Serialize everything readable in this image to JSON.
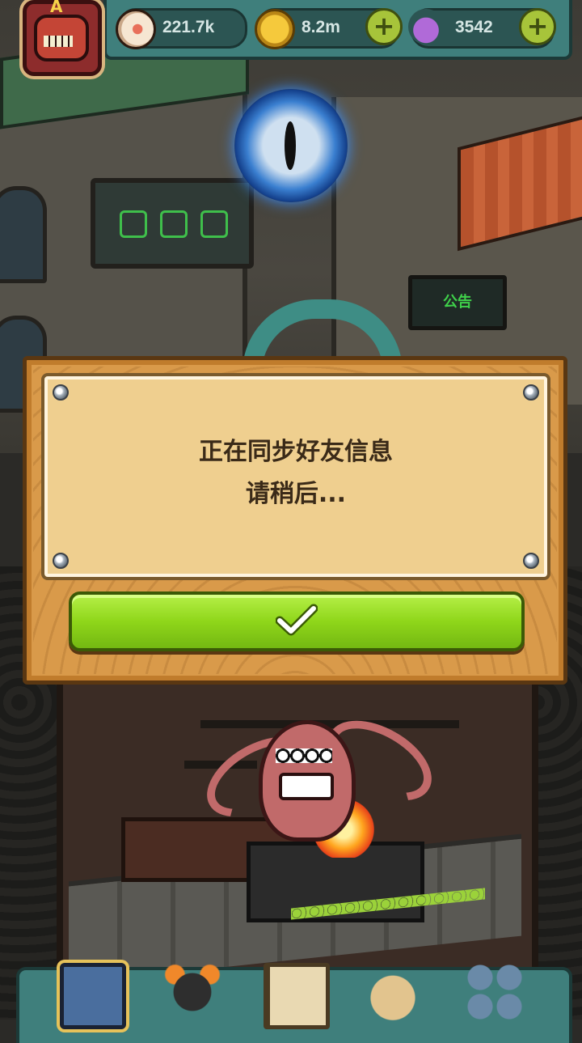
{
  "hud": {
    "avatar_letter": "A",
    "eyes": {
      "value": "221.7k",
      "icon": "eyeball-icon"
    },
    "coins": {
      "value": "8.2m",
      "icon": "coin-icon",
      "add_icon": "plus-icon"
    },
    "potions": {
      "value": "3542",
      "icon": "potion-icon",
      "add_icon": "plus-icon"
    }
  },
  "scene": {
    "announcement_sign": "公告"
  },
  "dialog": {
    "line1": "正在同步好友信息",
    "line2": "请稍后...",
    "confirm_icon": "checkmark-icon"
  },
  "bottom_nav": {
    "items": [
      {
        "icon": "building-icon"
      },
      {
        "icon": "monster-icon"
      },
      {
        "icon": "book-icon"
      },
      {
        "icon": "money-bag-icon"
      },
      {
        "icon": "grid-menu-icon"
      }
    ]
  },
  "colors": {
    "hud_teal": "#3f7f7c",
    "button_green": "#8fd61a",
    "wood": "#d99a4a",
    "parchment": "#efcf8f",
    "text_dark": "#3a2a18"
  }
}
